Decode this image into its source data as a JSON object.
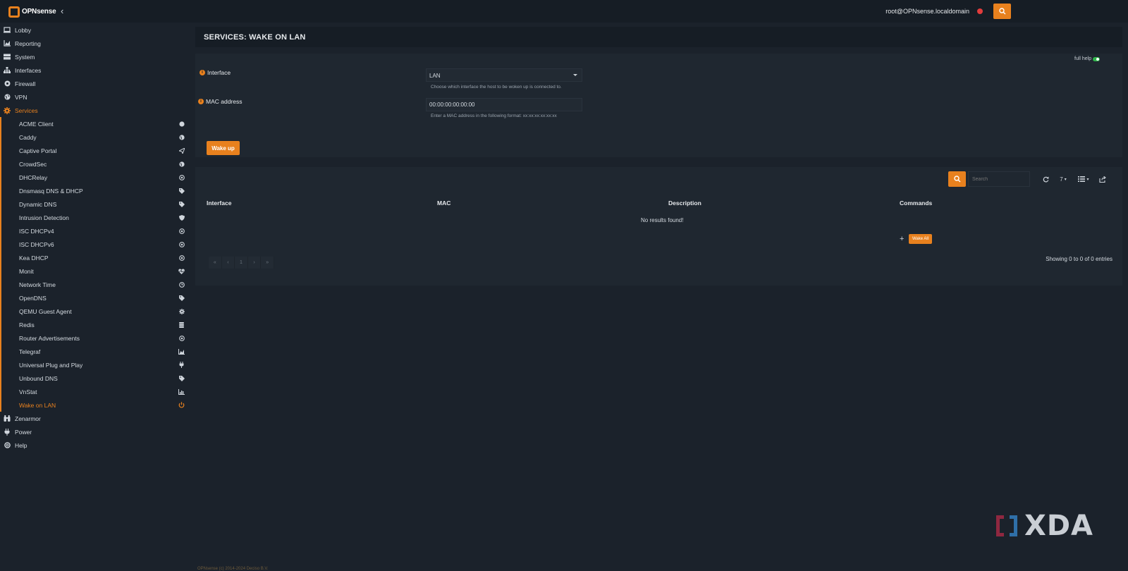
{
  "topbar": {
    "brand": "OPNsense",
    "user": "root@OPNsense.localdomain",
    "colors": {
      "accent": "#e8811e",
      "status_dot": "#e23c3c"
    }
  },
  "sidebar": {
    "items": [
      {
        "label": "Lobby",
        "icon": "laptop-icon"
      },
      {
        "label": "Reporting",
        "icon": "area-chart-icon"
      },
      {
        "label": "System",
        "icon": "server-icon"
      },
      {
        "label": "Interfaces",
        "icon": "sitemap-icon"
      },
      {
        "label": "Firewall",
        "icon": "fire-icon"
      },
      {
        "label": "VPN",
        "icon": "globe-icon"
      },
      {
        "label": "Services",
        "icon": "cog-icon",
        "active": true
      }
    ],
    "services": [
      {
        "label": "ACME Client",
        "icon": "circle-icon"
      },
      {
        "label": "Caddy",
        "icon": "globe-icon"
      },
      {
        "label": "Captive Portal",
        "icon": "paper-plane-icon"
      },
      {
        "label": "CrowdSec",
        "icon": "globe-icon"
      },
      {
        "label": "DHCRelay",
        "icon": "bullseye-icon"
      },
      {
        "label": "Dnsmasq DNS & DHCP",
        "icon": "tags-icon"
      },
      {
        "label": "Dynamic DNS",
        "icon": "tags-icon"
      },
      {
        "label": "Intrusion Detection",
        "icon": "shield-icon"
      },
      {
        "label": "ISC DHCPv4",
        "icon": "bullseye-icon"
      },
      {
        "label": "ISC DHCPv6",
        "icon": "bullseye-icon"
      },
      {
        "label": "Kea DHCP",
        "icon": "bullseye-icon"
      },
      {
        "label": "Monit",
        "icon": "heartbeat-icon"
      },
      {
        "label": "Network Time",
        "icon": "clock-icon"
      },
      {
        "label": "OpenDNS",
        "icon": "tags-icon"
      },
      {
        "label": "QEMU Guest Agent",
        "icon": "gear-icon"
      },
      {
        "label": "Redis",
        "icon": "database-icon"
      },
      {
        "label": "Router Advertisements",
        "icon": "bullseye-icon"
      },
      {
        "label": "Telegraf",
        "icon": "area-chart-icon"
      },
      {
        "label": "Universal Plug and Play",
        "icon": "plug-icon"
      },
      {
        "label": "Unbound DNS",
        "icon": "tags-icon"
      },
      {
        "label": "VnStat",
        "icon": "bar-chart-icon"
      },
      {
        "label": "Wake on LAN",
        "icon": "power-icon",
        "current": true
      }
    ],
    "bottom": [
      {
        "label": "Zenarmor",
        "icon": "binoculars-icon"
      },
      {
        "label": "Power",
        "icon": "plug-icon"
      },
      {
        "label": "Help",
        "icon": "life-ring-icon"
      }
    ]
  },
  "page": {
    "title": "SERVICES: WAKE ON LAN",
    "full_help": "full help"
  },
  "form": {
    "interface_label": "Interface",
    "interface_value": "LAN",
    "interface_help": "Choose which interface the host to be woken up is connected to.",
    "mac_label": "MAC address",
    "mac_value": "00:00:00:00:00:00",
    "mac_help": "Enter a MAC address in the following format: xx:xx:xx:xx:xx:xx",
    "wake_button": "Wake up"
  },
  "grid": {
    "search_placeholder": "Search",
    "page_size": "7",
    "columns": [
      "Interface",
      "MAC",
      "Description",
      "Commands"
    ],
    "empty_text": "No results found!",
    "wake_all": "Wake All",
    "pager": [
      "«",
      "‹",
      "1",
      "›",
      "»"
    ],
    "showing": "Showing 0 to 0 of 0 entries"
  },
  "footer": {
    "text": "OPNsense (c) 2014-2024 Deciso B.V."
  },
  "watermark": {
    "text": "XDA"
  }
}
